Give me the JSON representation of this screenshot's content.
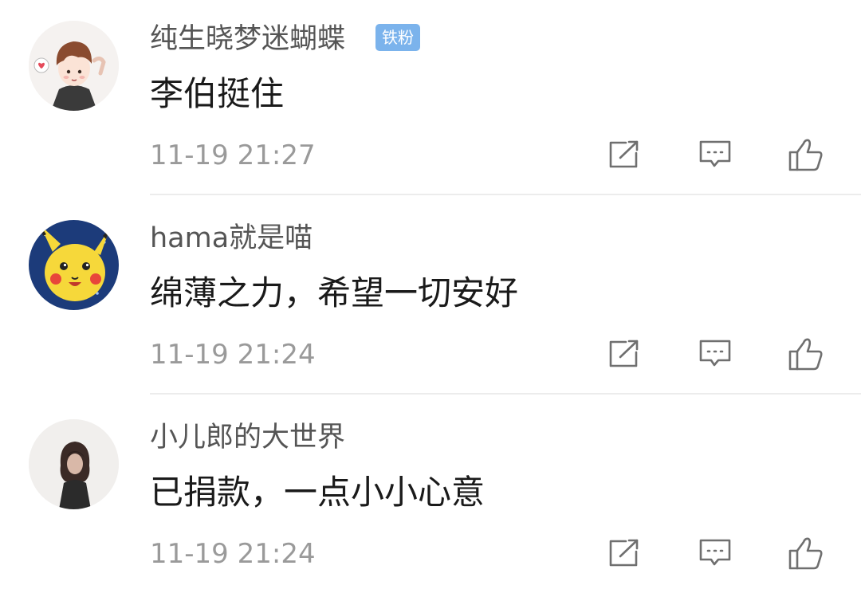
{
  "comments": [
    {
      "username": "纯生晓梦迷蝴蝶",
      "badge": "铁粉",
      "content": "李伯挺住",
      "time": "11-19 21:27",
      "avatar_icon": "cartoon-boy-avatar"
    },
    {
      "username": "hama就是喵",
      "content": "绵薄之力，希望一切安好",
      "time": "11-19 21:24",
      "avatar_icon": "pikachu-avatar"
    },
    {
      "username": "小儿郎的大世界",
      "content": "已捐款，一点小小心意",
      "time": "11-19 21:24",
      "avatar_icon": "woman-silhouette-avatar"
    }
  ],
  "actions": {
    "repost_icon": "repost-icon",
    "reply_icon": "comment-icon",
    "like_icon": "thumbs-up-icon"
  },
  "colors": {
    "username": "#555555",
    "content": "#1a1a1a",
    "time": "#9a9a9a",
    "badge_bg": "#7bb3ec",
    "icon_stroke": "#6f6f6f",
    "divider": "#ececec"
  }
}
